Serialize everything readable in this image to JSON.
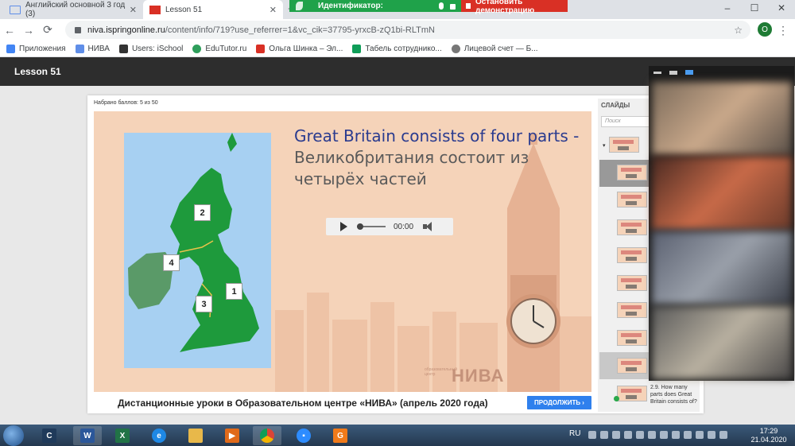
{
  "browser": {
    "tabs": [
      {
        "title": "Английский основной 3 год (3)"
      },
      {
        "title": "Lesson 51"
      }
    ],
    "screen_share": {
      "id_label": "Идентификатор:",
      "stop_label": "Остановить демонстрацию"
    },
    "url_host": "niva.ispringonline.ru",
    "url_path": "/content/info/719?use_referrer=1&vc_cik=37795-yrxcB-zQ1bi-RLTmN",
    "profile_initial": "O",
    "bookmarks": [
      {
        "label": "Приложения",
        "color": "#4285f4"
      },
      {
        "label": "НИВА",
        "color": "#5f8ee8"
      },
      {
        "label": "Users: iSchool",
        "color": "#333333"
      },
      {
        "label": "EduTutor.ru",
        "color": "#2e9e5b"
      },
      {
        "label": "Ольга Шинка – Эл...",
        "color": "#d93025"
      },
      {
        "label": "Табель сотруднико...",
        "color": "#0f9d58"
      },
      {
        "label": "Лицевой счет — Б...",
        "color": "#777777"
      }
    ]
  },
  "player": {
    "title": "Lesson 51",
    "score": "Набрано баллов: 5 из 50",
    "slide": {
      "title_en": "Great Britain consists of four parts -",
      "title_ru": "Великобритания состоит из четырёх частей",
      "audio_time": "00:00",
      "markers": [
        "1",
        "2",
        "3",
        "4"
      ],
      "logo_small": "образовательный центр",
      "logo_big": "НИВА"
    },
    "footer": "Дистанционные уроки в Образовательном центре «НИВА» (апрель 2020 года)",
    "continue_label": "ПРОДОЛЖИТЬ ›",
    "sidebar": {
      "heading": "СЛАЙДЫ",
      "search_placeholder": "Поиск",
      "last_caption": "2.9. How many parts does Great Britain consists of?"
    }
  },
  "taskbar": {
    "lang": "RU",
    "time": "17:29",
    "date": "21.04.2020"
  },
  "colors": {
    "slide_bg": "#f5d3b9",
    "title_blue": "#2a3b8f",
    "land_green": "#1e9a3c",
    "ireland_green": "#5a9a68",
    "continue_blue": "#2f80ed"
  }
}
